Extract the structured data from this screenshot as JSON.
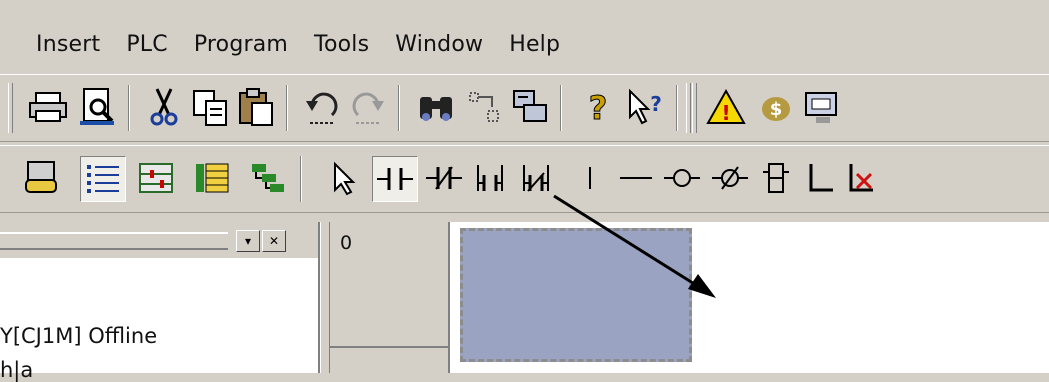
{
  "menu": [
    "Insert",
    "PLC",
    "Program",
    "Tools",
    "Window",
    "Help"
  ],
  "toolbar1_icons": [
    "print-icon",
    "print-preview-icon",
    "cut-icon",
    "copy-icon",
    "paste-icon",
    "undo-icon",
    "redo-icon",
    "find-icon",
    "replace-icon",
    "compare-icon",
    "help-icon",
    "context-help-icon",
    "warning-icon",
    "transfer-icon",
    "online-icon"
  ],
  "toolbar2_icons": [
    "project-icon",
    "list-view-icon",
    "ladder-view-icon",
    "table-view-icon",
    "tree-view-icon",
    "select-pointer-icon",
    "no-contact-icon",
    "nc-contact-icon",
    "or-contact-icon",
    "or-nc-contact-icon",
    "vertical-line-icon",
    "horizontal-line-icon",
    "coil-icon",
    "nc-coil-icon",
    "instruction-icon",
    "line-connect-icon",
    "delete-icon"
  ],
  "left_pane": {
    "line1": "Y[CJ1M] Offline",
    "line2": "h|a"
  },
  "ladder": {
    "rung_number": "0"
  },
  "colors": {
    "chrome": "#d4d0c8",
    "cursor": "#9aa3c1"
  }
}
